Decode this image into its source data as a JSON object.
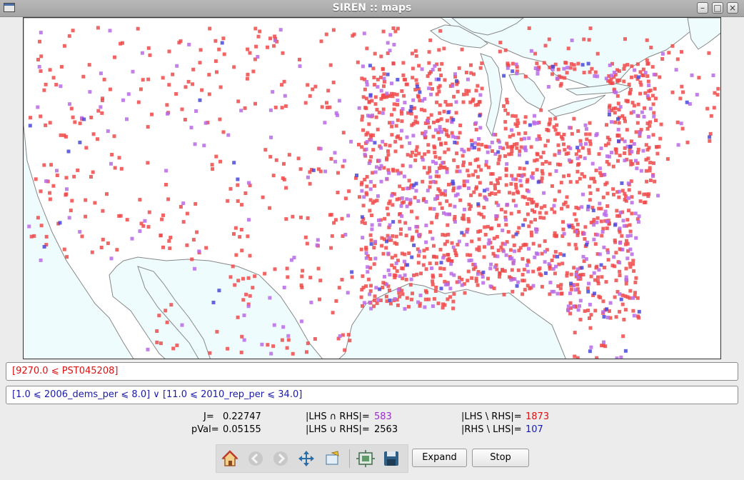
{
  "window": {
    "title": "SIREN :: maps"
  },
  "map": {
    "rule_counts": {
      "lhs_only": 1873,
      "both": 583,
      "rhs_only": 107
    },
    "colors": {
      "lhs_only": "#f04a4a",
      "both": "#b86ae8",
      "rhs_only": "#4a4adc",
      "water": "#eefcfd",
      "land": "#ffffff"
    }
  },
  "lhs": {
    "text": "[9270.0 ⩽ PST045208]",
    "color": "#dd1111"
  },
  "rhs": {
    "text": "[1.0 ⩽ 2006_dems_per ⩽ 8.0] ∨  [11.0 ⩽ 2010_rep_per ⩽ 34.0]",
    "color": "#1a1aaa"
  },
  "stats": {
    "j_label": "J=",
    "j_value": "0.22747",
    "pval_label": "pVal=",
    "pval_value": "0.05155",
    "intersect_label": "|LHS ∩ RHS|=",
    "intersect_value": "583",
    "union_label": "|LHS ∪ RHS|=",
    "union_value": "2563",
    "lhs_minus_label": "|LHS \\ RHS|=",
    "lhs_minus_value": "1873",
    "rhs_minus_label": "|RHS \\ LHS|=",
    "rhs_minus_value": "107"
  },
  "toolbar": {
    "icons": [
      "home-icon",
      "back-icon",
      "forward-icon",
      "pan-icon",
      "zoom-icon",
      "configure-subplots-icon",
      "save-icon"
    ]
  },
  "buttons": {
    "expand": "Expand",
    "stop": "Stop"
  }
}
